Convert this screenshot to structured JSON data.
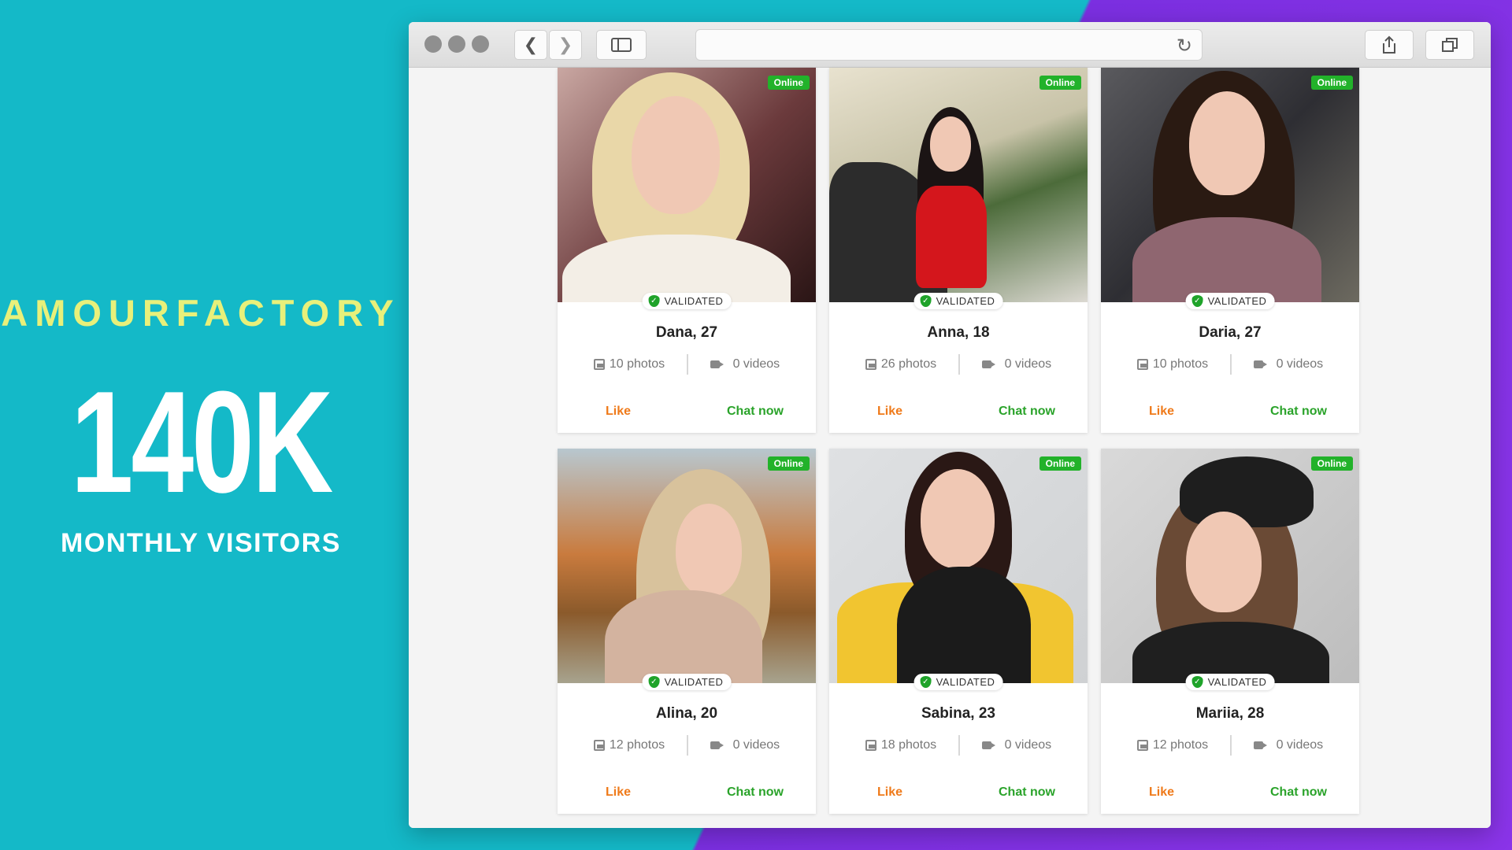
{
  "promo": {
    "brand": "AMOURFACTORY",
    "big_number": "140K",
    "subtitle": "MONTHLY VISITORS"
  },
  "browser": {
    "toolbar_icons": [
      "back-icon",
      "forward-icon",
      "sidebar-icon",
      "reload-icon",
      "share-icon",
      "tabs-icon"
    ]
  },
  "colors": {
    "background_teal": "#14b9c8",
    "background_purple": "#7b2fe0",
    "brand_yellow": "#e8f07a",
    "online_green": "#22b22a",
    "like_orange": "#ef7a1a",
    "chat_green": "#2aa32a"
  },
  "profiles": [
    {
      "name": "Dana, 27",
      "photos": "10 photos",
      "videos": "0 videos",
      "status": "Online",
      "badge": "VALIDATED",
      "like": "Like",
      "chat": "Chat now"
    },
    {
      "name": "Anna, 18",
      "photos": "26 photos",
      "videos": "0 videos",
      "status": "Online",
      "badge": "VALIDATED",
      "like": "Like",
      "chat": "Chat now"
    },
    {
      "name": "Daria, 27",
      "photos": "10 photos",
      "videos": "0 videos",
      "status": "Online",
      "badge": "VALIDATED",
      "like": "Like",
      "chat": "Chat now"
    },
    {
      "name": "Alina, 20",
      "photos": "12 photos",
      "videos": "0 videos",
      "status": "Online",
      "badge": "VALIDATED",
      "like": "Like",
      "chat": "Chat now"
    },
    {
      "name": "Sabina, 23",
      "photos": "18 photos",
      "videos": "0 videos",
      "status": "Online",
      "badge": "VALIDATED",
      "like": "Like",
      "chat": "Chat now"
    },
    {
      "name": "Mariia, 28",
      "photos": "12 photos",
      "videos": "0 videos",
      "status": "Online",
      "badge": "VALIDATED",
      "like": "Like",
      "chat": "Chat now"
    }
  ]
}
